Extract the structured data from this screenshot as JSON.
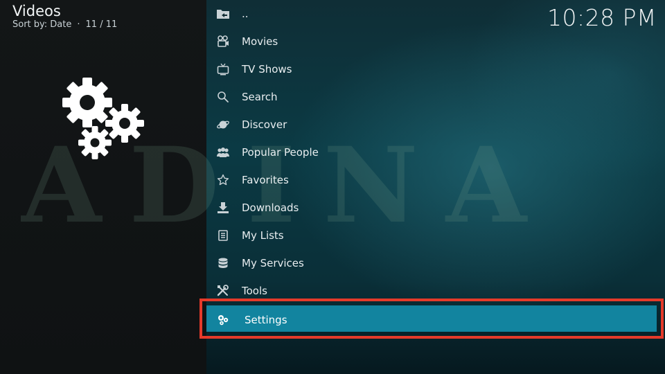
{
  "header": {
    "title": "Videos",
    "sort_label": "Sort by: Date",
    "count": "11 / 11",
    "clock": "10:28 PM"
  },
  "background": {
    "watermark": "ADINA"
  },
  "menu": {
    "items": [
      {
        "label": "..",
        "icon": "folder-back-icon"
      },
      {
        "label": "Movies",
        "icon": "film-camera-icon"
      },
      {
        "label": "TV Shows",
        "icon": "tv-icon"
      },
      {
        "label": "Search",
        "icon": "search-icon"
      },
      {
        "label": "Discover",
        "icon": "planet-icon"
      },
      {
        "label": "Popular People",
        "icon": "people-icon"
      },
      {
        "label": "Favorites",
        "icon": "star-icon"
      },
      {
        "label": "Downloads",
        "icon": "download-icon"
      },
      {
        "label": "My Lists",
        "icon": "list-icon"
      },
      {
        "label": "My Services",
        "icon": "database-icon"
      },
      {
        "label": "Tools",
        "icon": "tools-icon"
      },
      {
        "label": "Settings",
        "icon": "gears-icon"
      }
    ],
    "selected_index": 11
  },
  "colors": {
    "selection_fill": "#12849f",
    "selection_border": "#e53a2a"
  }
}
